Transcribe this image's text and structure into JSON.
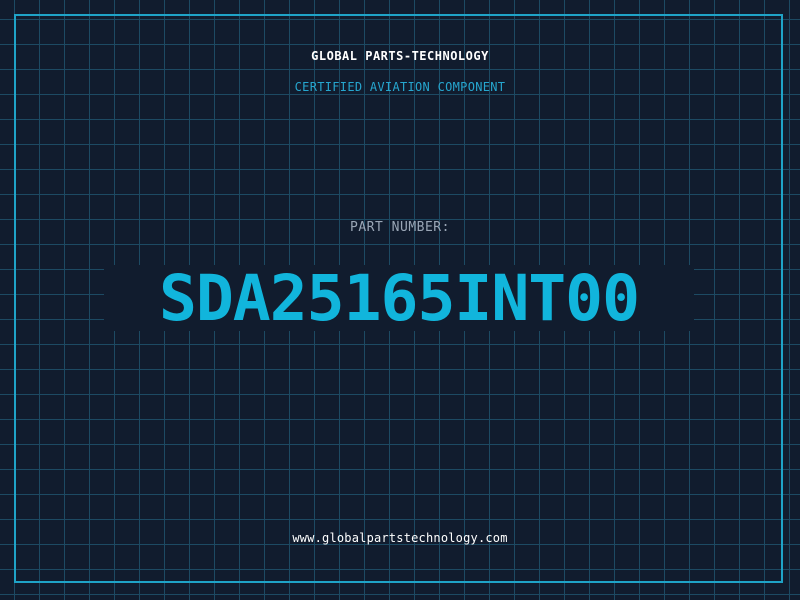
{
  "header": {
    "company_name": "GLOBAL PARTS-TECHNOLOGY",
    "subtitle": "CERTIFIED AVIATION COMPONENT"
  },
  "part": {
    "label": "PART NUMBER:",
    "number": "SDA25165INT00"
  },
  "footer": {
    "website": "www.globalpartstechnology.com"
  },
  "colors": {
    "background": "#111c2e",
    "grid_line": "#1d4a63",
    "border": "#1fa3c7",
    "accent": "#11b5dc",
    "subtitle": "#26a6cf",
    "label": "#9aa6b6",
    "text": "#ffffff"
  }
}
